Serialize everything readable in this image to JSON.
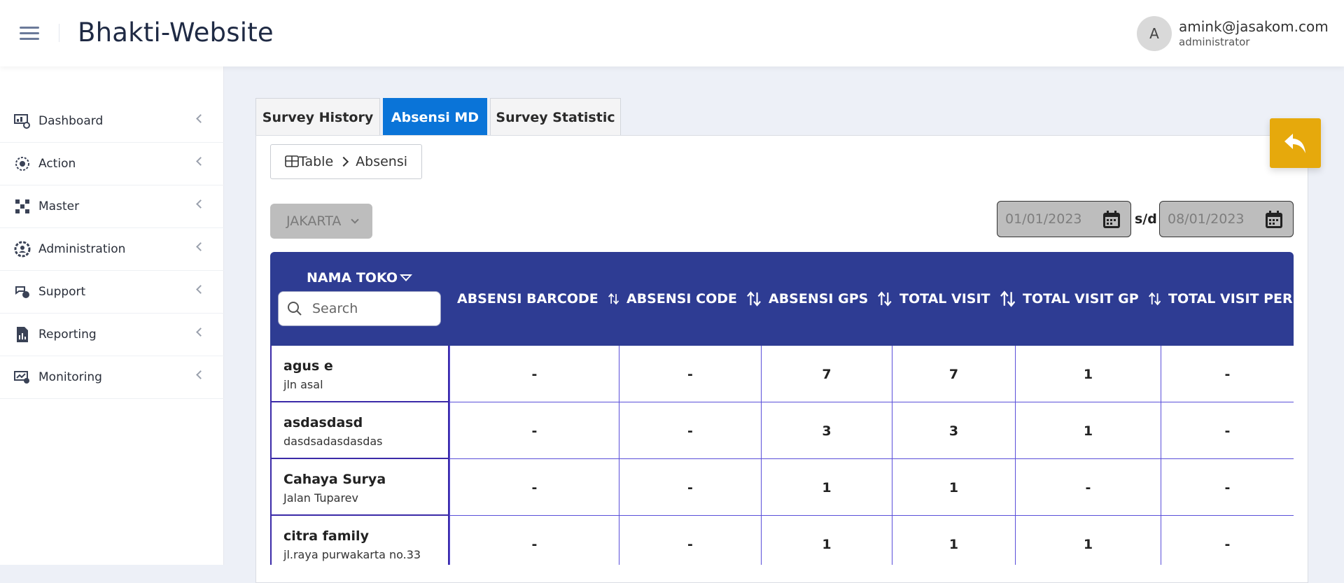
{
  "header": {
    "title": "Bhakti-Website",
    "user": {
      "avatar_letter": "A",
      "email": "amink@jasakom.com",
      "role": "administrator"
    }
  },
  "sidebar": {
    "items": [
      {
        "label": "Dashboard",
        "icon": "dashboard-icon"
      },
      {
        "label": "Action",
        "icon": "action-icon"
      },
      {
        "label": "Master",
        "icon": "master-icon"
      },
      {
        "label": "Administration",
        "icon": "administration-icon"
      },
      {
        "label": "Support",
        "icon": "support-icon"
      },
      {
        "label": "Reporting",
        "icon": "reporting-icon"
      },
      {
        "label": "Monitoring",
        "icon": "monitoring-icon"
      }
    ]
  },
  "tabs": [
    {
      "label": "Survey History",
      "active": false
    },
    {
      "label": "Absensi MD",
      "active": true
    },
    {
      "label": "Survey Statistic",
      "active": false
    }
  ],
  "breadcrumb": {
    "root": "Table",
    "current": "Absensi"
  },
  "filters": {
    "city": "JAKARTA",
    "date_from": "01/01/2023",
    "separator": "s/d",
    "date_to": "08/01/2023"
  },
  "colors": {
    "accent": "#0a74d8",
    "table_header": "#2e3c93",
    "back_button": "#e6a90c",
    "grid_line": "#5a4fd9"
  },
  "table": {
    "first_column": "NAMA TOKO",
    "search_placeholder": "Search",
    "columns": [
      "ABSENSI BARCODE",
      "ABSENSI CODE",
      "ABSENSI GPS",
      "TOTAL VISIT",
      "TOTAL VISIT GP",
      "TOTAL VISIT PERIO"
    ],
    "rows": [
      {
        "name": "agus e",
        "address": "jln asal",
        "values": [
          "-",
          "-",
          "7",
          "7",
          "1",
          "-"
        ]
      },
      {
        "name": "asdasdasd",
        "address": "dasdsadasdasdas",
        "values": [
          "-",
          "-",
          "3",
          "3",
          "1",
          "-"
        ]
      },
      {
        "name": "Cahaya Surya",
        "address": "Jalan Tuparev",
        "values": [
          "-",
          "-",
          "1",
          "1",
          "-",
          "-"
        ]
      },
      {
        "name": "citra family",
        "address": "jl.raya purwakarta no.33",
        "values": [
          "-",
          "-",
          "1",
          "1",
          "1",
          "-"
        ]
      }
    ]
  }
}
